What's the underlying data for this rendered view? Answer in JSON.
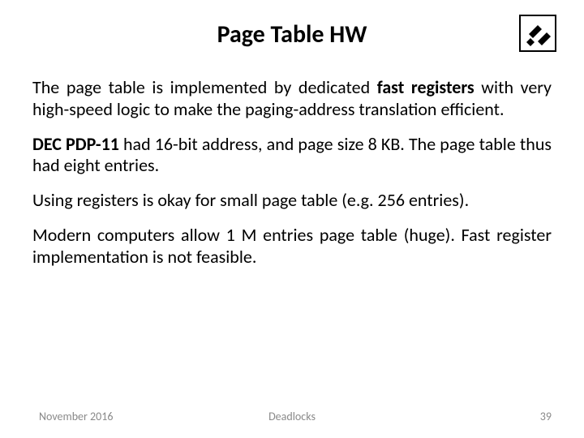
{
  "title": "Page Table HW",
  "logo_name": "technion-logo",
  "paragraphs": {
    "p1a": "The page table is implemented by dedicated ",
    "p1b": "fast registers",
    "p1c": " with very high-speed logic to make the paging-address translation efficient.",
    "p2a": "DEC PDP-11",
    "p2b": " had 16-bit address, and page size 8 KB. The page table thus had eight entries.",
    "p3": "Using registers is okay for small page table (e.g. 256 entries).",
    "p4": "Modern computers allow 1 M entries page table (huge). Fast register implementation is not feasible."
  },
  "footer": {
    "date": "November 2016",
    "topic": "Deadlocks",
    "page": "39"
  }
}
